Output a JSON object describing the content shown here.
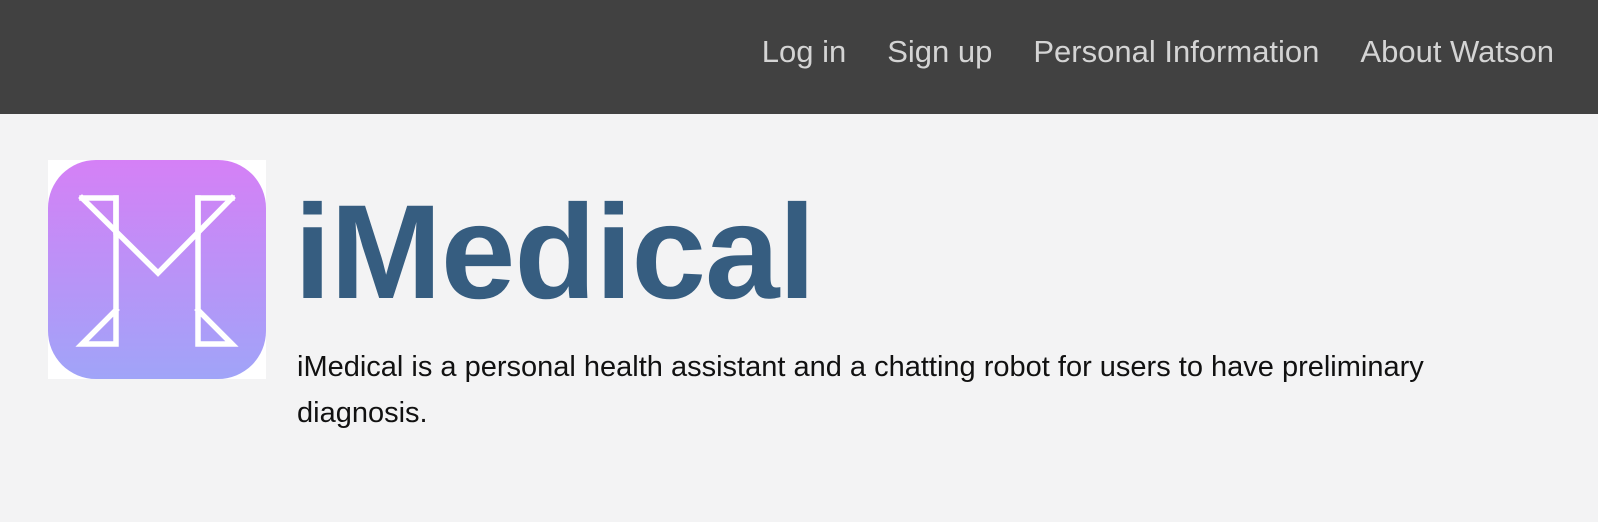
{
  "nav": {
    "items": [
      {
        "label": "Log in"
      },
      {
        "label": "Sign up"
      },
      {
        "label": "Personal Information"
      },
      {
        "label": "About Watson"
      }
    ]
  },
  "logo": {
    "icon": "m-letter-logo-icon",
    "gradient_top": "#d580f6",
    "gradient_bottom": "#a0a4f8"
  },
  "hero": {
    "title": "iMedical",
    "description": "iMedical is a personal health assistant and a chatting robot for users to have preliminary diagnosis."
  },
  "colors": {
    "navbar": "#414141",
    "nav_text": "#d4d4d4",
    "page_background": "#f3f3f4",
    "title": "#365d80",
    "body_text": "#111111"
  }
}
